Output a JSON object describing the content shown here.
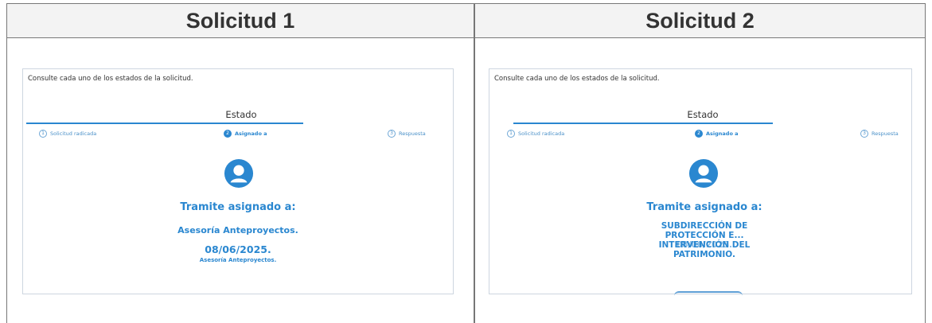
{
  "columns": [
    {
      "title": "Solicitud 1",
      "panel": {
        "intro": "Consulte cada uno de los estados de la solicitud.",
        "estado_label": "Estado",
        "steps": [
          {
            "num": "1",
            "label": "Solicitud radicada"
          },
          {
            "num": "2",
            "label": "Asignado a"
          },
          {
            "num": "3",
            "label": "Respuesta"
          }
        ],
        "active_step": 2,
        "assigned_title": "Tramite asignado a:",
        "assigned_name": "Asesoría Anteproyectos.",
        "date": "08/06/2025.",
        "sub": "Asesoría Anteproyectos."
      }
    },
    {
      "title": "Solicitud 2",
      "panel": {
        "intro": "Consulte cada uno de los estados de la solicitud.",
        "estado_label": "Estado",
        "steps": [
          {
            "num": "1",
            "label": "Solicitud radicada"
          },
          {
            "num": "2",
            "label": "Asignado a"
          },
          {
            "num": "3",
            "label": "Respuesta"
          }
        ],
        "active_step": 2,
        "assigned_title": "Tramite asignado a:",
        "assigned_name_lines": [
          "SUBDIRECCIÓN DE",
          "PROTECCIÓN E...",
          "INTERVENCIÓN DEL",
          "PATRIMONIO."
        ],
        "date": "08/06/2025."
      }
    }
  ],
  "colors": {
    "accent": "#2a87d0",
    "border": "#777777",
    "panel_border": "#cdd6e0"
  },
  "icons": {
    "avatar": "user-avatar-icon"
  }
}
